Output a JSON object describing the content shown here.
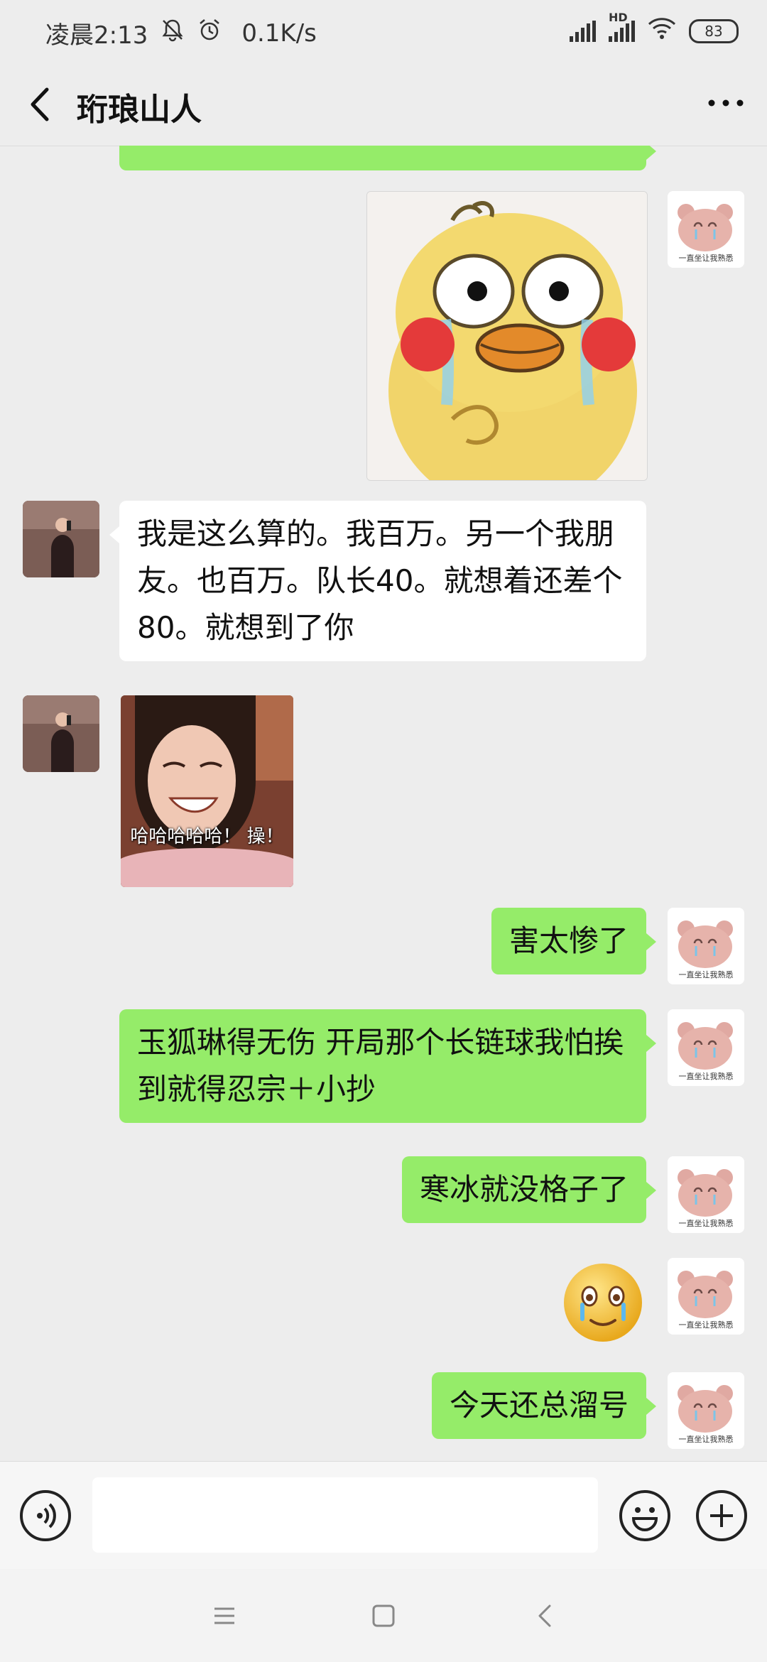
{
  "status_bar": {
    "time": "凌晨2:13",
    "net_speed": "0.1K/s",
    "network_label": "HD",
    "battery": "83",
    "icons": [
      "bell-muted-icon",
      "alarm-icon",
      "signal-icon",
      "signal-hd-icon",
      "wifi-icon",
      "battery-icon"
    ]
  },
  "header": {
    "back_icon": "chevron-left-icon",
    "title": "珩琅山人",
    "more_icon": "more-dots-icon"
  },
  "messages": [
    {
      "sender": "me",
      "type": "text-partial",
      "text": ""
    },
    {
      "sender": "me",
      "type": "sticker",
      "sticker": "crying-yellow-duck"
    },
    {
      "sender": "other",
      "type": "text",
      "text": "我是这么算的。我百万。另一个我朋友。也百万。队长40。就想着还差个80。就想到了你"
    },
    {
      "sender": "other",
      "type": "sticker",
      "sticker": "laughing-girl",
      "caption": "哈哈哈哈哈！ 操！"
    },
    {
      "sender": "me",
      "type": "text",
      "text": "害太惨了"
    },
    {
      "sender": "me",
      "type": "text",
      "text": "玉狐琳得无伤 开局那个长链球我怕挨到就得忍宗＋小抄"
    },
    {
      "sender": "me",
      "type": "text",
      "text": "寒冰就没格子了"
    },
    {
      "sender": "me",
      "type": "emoji",
      "emoji": "😢"
    },
    {
      "sender": "me",
      "type": "text",
      "text": "今天还总溜号"
    }
  ],
  "avatars": {
    "me_caption": "一直坐让我熟悉",
    "me_icon": "crying-bear-avatar",
    "other_icon": "person-phone-avatar"
  },
  "input_bar": {
    "voice_icon": "voice-icon",
    "text_value": "",
    "emoji_icon": "emoji-icon",
    "plus_icon": "plus-icon"
  },
  "nav_bar": {
    "icons": [
      "menu-icon",
      "home-square-icon",
      "back-triangle-icon"
    ]
  },
  "colors": {
    "me_bubble": "#95ec69",
    "other_bubble": "#ffffff",
    "chat_bg": "#ededed"
  }
}
